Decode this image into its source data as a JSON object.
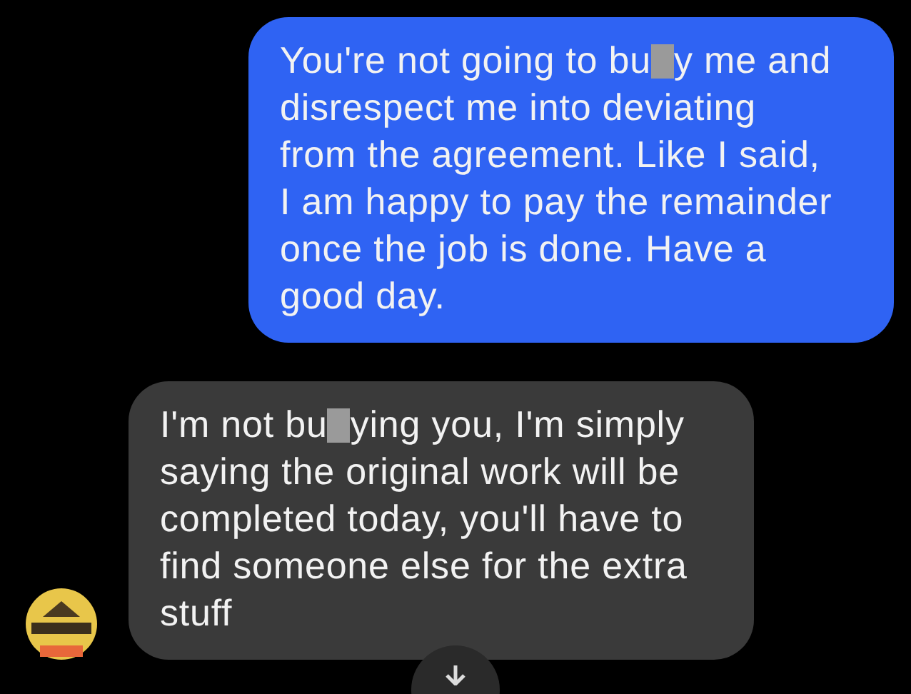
{
  "messages": [
    {
      "kind": "sent",
      "parts": [
        {
          "kind": "text",
          "text": "You're not going to bu"
        },
        {
          "kind": "redaction"
        },
        {
          "kind": "text",
          "text": "y me and\ndisrespect me into deviating\nfrom the agreement. Like I said,\nI am happy to pay the remainder\nonce the job is done. Have a\ngood day."
        }
      ]
    },
    {
      "kind": "received",
      "parts": [
        {
          "kind": "text",
          "text": "I'm not bu"
        },
        {
          "kind": "redaction"
        },
        {
          "kind": "text",
          "text": "ying you, I'm simply\nsaying the original work will be\ncompleted today, you'll have to\nfind someone else for the extra\nstuff"
        }
      ]
    }
  ]
}
